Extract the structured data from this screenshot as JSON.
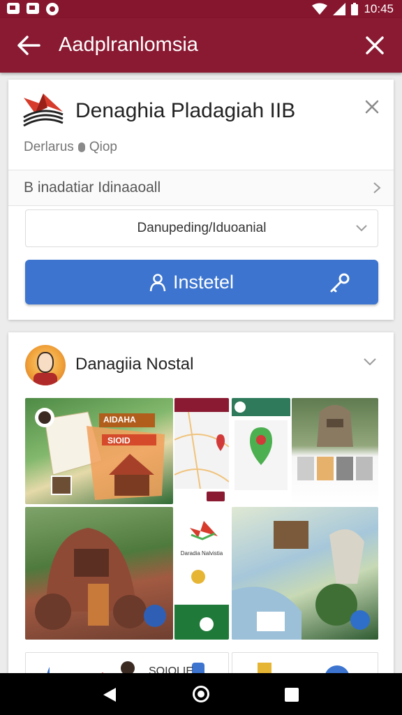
{
  "status_bar": {
    "time": "10:45"
  },
  "app_bar": {
    "title": "Aadplranlomsia"
  },
  "app": {
    "name": "Denaghia Pladagiah IIB",
    "meta_left": "Derlarus",
    "meta_right": "Qiop",
    "link_row": "B inadatiar Idinaaoall",
    "dropdown_value": "Danupeding/Iduoanial",
    "install_label": "Instetel"
  },
  "developer": {
    "name": "Danagiia Nostal"
  },
  "screenshots": {
    "s1_banner_top": "AIDAHA",
    "s1_banner_sign": "SIOID",
    "s6_caption": "Daradia Nalvistia",
    "s8_caption": "SOIOLIE"
  },
  "colors": {
    "status_bar": "#86162e",
    "app_bar": "#8a1a32",
    "install_button": "#3c74cf",
    "background": "#ececec",
    "map_pin": "#d23a3a",
    "map_green": "#4caf50"
  },
  "icons": {
    "back": "arrow-left",
    "close": "x",
    "dismiss": "x",
    "install_user": "user",
    "install_key": "key",
    "expand": "chevron-down",
    "navigate": "chevron-right"
  }
}
